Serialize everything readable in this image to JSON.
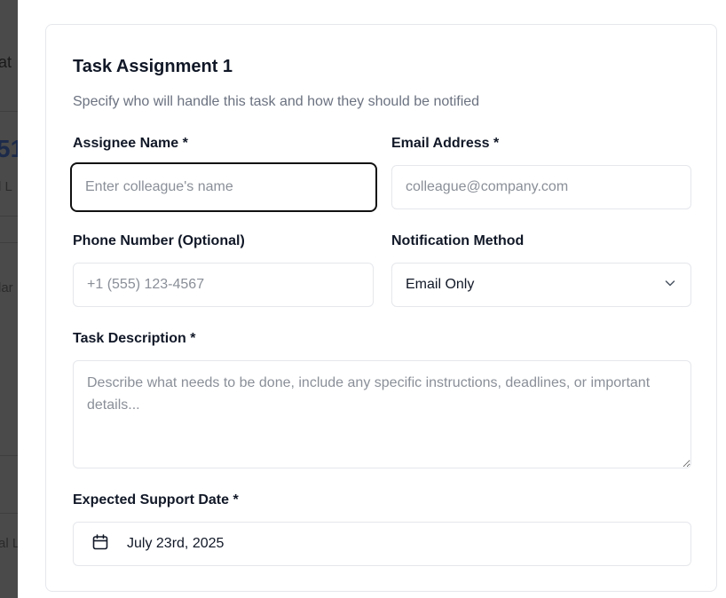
{
  "form": {
    "title": "Task Assignment 1",
    "subtitle": "Specify who will handle this task and how they should be notified",
    "assignee": {
      "label": "Assignee Name *",
      "placeholder": "Enter colleague's name",
      "value": ""
    },
    "email": {
      "label": "Email Address *",
      "placeholder": "colleague@company.com",
      "value": ""
    },
    "phone": {
      "label": "Phone Number (Optional)",
      "placeholder": "+1 (555) 123-4567",
      "value": ""
    },
    "notification": {
      "label": "Notification Method",
      "selected": "Email Only",
      "icon": "chevron-down-icon"
    },
    "description": {
      "label": "Task Description *",
      "placeholder": "Describe what needs to be done, include any specific instructions, deadlines, or important details...",
      "value": ""
    },
    "support_date": {
      "label": "Expected Support Date *",
      "value": "July 23rd, 2025",
      "icon": "calendar-icon"
    }
  },
  "backdrop": {
    "fragments": [
      "at",
      "51",
      "l L",
      "lar",
      "al L"
    ]
  },
  "colors": {
    "focus_border": "#111111",
    "field_border": "#e5e7eb",
    "muted_text": "#6b7280",
    "overlay": "#3b3b3b"
  }
}
